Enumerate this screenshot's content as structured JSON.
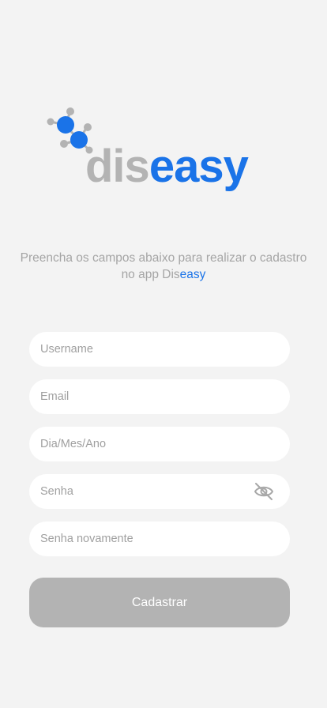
{
  "brand": {
    "part1": "dis",
    "part2": "easy",
    "accent_color": "#1a73e8",
    "muted_color": "#b3b3b3"
  },
  "subtitle": {
    "text": "Preencha os campos abaixo para realizar o cadastro no app ",
    "brand_part1": "Dis",
    "brand_part2": "easy"
  },
  "form": {
    "username_placeholder": "Username",
    "email_placeholder": "Email",
    "birthdate_placeholder": "Dia/Mes/Ano",
    "password_placeholder": "Senha",
    "password_confirm_placeholder": "Senha novamente",
    "password_toggle_icon": "eye-off-icon",
    "submit_label": "Cadastrar",
    "submit_color": "#b3b3b3"
  }
}
